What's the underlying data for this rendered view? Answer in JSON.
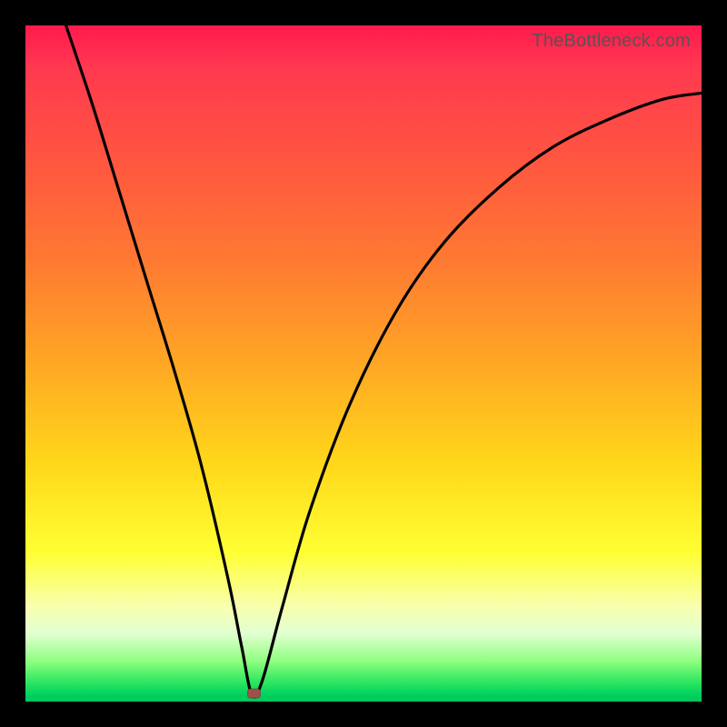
{
  "watermark": "TheBottleneck.com",
  "colors": {
    "background": "#000000",
    "gradient_top": "#ff1a4d",
    "gradient_bottom": "#00c858",
    "curve": "#000000",
    "marker": "#a05048"
  },
  "chart_data": {
    "type": "line",
    "title": "",
    "xlabel": "",
    "ylabel": "",
    "xlim": [
      0,
      100
    ],
    "ylim": [
      0,
      100
    ],
    "annotations": [
      "TheBottleneck.com"
    ],
    "legend": false,
    "grid": false,
    "series": [
      {
        "name": "bottleneck-curve",
        "x": [
          6,
          10,
          14,
          18,
          22,
          26,
          30,
          32,
          33.5,
          35,
          38,
          42,
          48,
          55,
          62,
          70,
          78,
          86,
          94,
          100
        ],
        "y": [
          100,
          88,
          75,
          62,
          49,
          35,
          18,
          8,
          1,
          3,
          14,
          28,
          44,
          58,
          68,
          76,
          82,
          86,
          89,
          90
        ]
      }
    ],
    "marker": {
      "x": 33.8,
      "y": 1.2,
      "shape": "rounded-rect"
    }
  }
}
